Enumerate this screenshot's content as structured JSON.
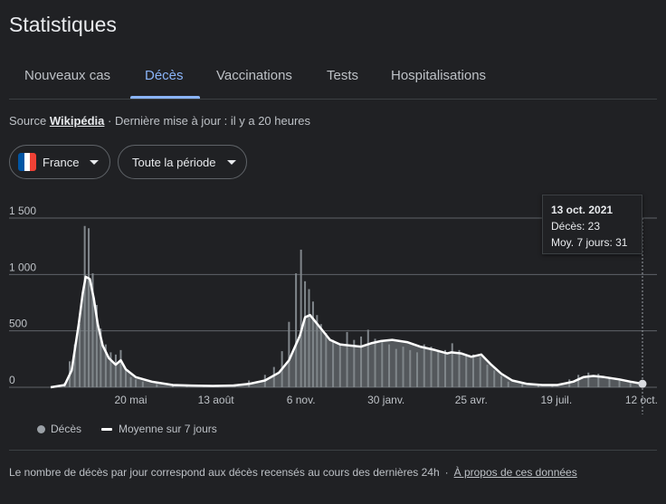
{
  "header": {
    "title": "Statistiques"
  },
  "tabs": [
    {
      "label": "Nouveaux cas",
      "active": false
    },
    {
      "label": "Décès",
      "active": true
    },
    {
      "label": "Vaccinations",
      "active": false
    },
    {
      "label": "Tests",
      "active": false
    },
    {
      "label": "Hospitalisations",
      "active": false
    }
  ],
  "source": {
    "prefix": "Source",
    "link": "Wikipédia",
    "updated": "· Dernière mise à jour : il y a 20 heures"
  },
  "filters": {
    "country": {
      "label": "France",
      "icon": "france-flag-icon",
      "flag_colors": [
        "#0055A4",
        "#FFFFFF",
        "#EF4135"
      ]
    },
    "period": {
      "label": "Toute la période"
    }
  },
  "tooltip": {
    "date": "13 oct. 2021",
    "deaths_line": "Décès: 23",
    "avg_line": "Moy. 7 jours: 31"
  },
  "legend": {
    "bars_label": "Décès",
    "line_label": "Moyenne sur 7 jours"
  },
  "footer": {
    "note": "Le nombre de décès par jour correspond aux décès recensés au cours des dernières 24h",
    "separator": "·",
    "link": "À propos de ces données"
  },
  "colors": {
    "background": "#202124",
    "accent": "#8ab4f8",
    "bars": "#80868b",
    "avg_line": "#ffffff",
    "grid": "#5f6368"
  },
  "chart_data": {
    "type": "bar",
    "title": "",
    "xlabel": "",
    "ylabel": "",
    "ylim": [
      0,
      1500
    ],
    "yticks": [
      "0",
      "500",
      "1 000",
      "1 500"
    ],
    "xticks": [
      "20 mai",
      "13 août",
      "6 nov.",
      "30 janv.",
      "25 avr.",
      "19 juil.",
      "12 oct."
    ],
    "grid": true,
    "x_range": [
      "2020-03-01",
      "2021-10-13"
    ],
    "series": [
      {
        "name": "Décès",
        "kind": "bar",
        "x": [
          "2020-03-10",
          "2020-03-15",
          "2020-03-20",
          "2020-03-25",
          "2020-03-30",
          "2020-04-04",
          "2020-04-08",
          "2020-04-12",
          "2020-04-16",
          "2020-04-20",
          "2020-04-25",
          "2020-04-30",
          "2020-05-05",
          "2020-05-10",
          "2020-05-15",
          "2020-05-20",
          "2020-05-25",
          "2020-06-01",
          "2020-06-15",
          "2020-07-01",
          "2020-07-15",
          "2020-08-01",
          "2020-08-15",
          "2020-09-01",
          "2020-09-15",
          "2020-10-01",
          "2020-10-10",
          "2020-10-18",
          "2020-10-25",
          "2020-11-01",
          "2020-11-06",
          "2020-11-10",
          "2020-11-14",
          "2020-11-18",
          "2020-11-22",
          "2020-11-26",
          "2020-12-01",
          "2020-12-08",
          "2020-12-15",
          "2020-12-22",
          "2020-12-29",
          "2021-01-05",
          "2021-01-12",
          "2021-01-19",
          "2021-01-26",
          "2021-02-02",
          "2021-02-09",
          "2021-02-16",
          "2021-02-23",
          "2021-03-02",
          "2021-03-09",
          "2021-03-16",
          "2021-03-23",
          "2021-03-30",
          "2021-04-06",
          "2021-04-13",
          "2021-04-20",
          "2021-04-27",
          "2021-05-04",
          "2021-05-11",
          "2021-05-18",
          "2021-05-25",
          "2021-06-01",
          "2021-06-15",
          "2021-07-01",
          "2021-07-15",
          "2021-08-01",
          "2021-08-10",
          "2021-08-20",
          "2021-08-30",
          "2021-09-10",
          "2021-09-20",
          "2021-10-01",
          "2021-10-13"
        ],
        "values": [
          5,
          40,
          230,
          380,
          560,
          1430,
          1410,
          1010,
          730,
          520,
          380,
          310,
          290,
          330,
          150,
          90,
          70,
          50,
          30,
          20,
          15,
          12,
          15,
          25,
          60,
          110,
          180,
          320,
          580,
          1010,
          1220,
          940,
          870,
          760,
          640,
          560,
          480,
          420,
          380,
          490,
          420,
          450,
          510,
          430,
          400,
          380,
          340,
          360,
          330,
          310,
          380,
          360,
          330,
          330,
          390,
          330,
          280,
          290,
          270,
          200,
          150,
          100,
          50,
          30,
          15,
          20,
          70,
          110,
          130,
          120,
          80,
          60,
          40,
          23
        ]
      },
      {
        "name": "Moyenne sur 7 jours",
        "kind": "line",
        "x": [
          "2020-03-01",
          "2020-03-15",
          "2020-03-22",
          "2020-03-29",
          "2020-04-02",
          "2020-04-05",
          "2020-04-09",
          "2020-04-13",
          "2020-04-17",
          "2020-04-22",
          "2020-04-28",
          "2020-05-05",
          "2020-05-10",
          "2020-05-15",
          "2020-05-25",
          "2020-06-10",
          "2020-07-01",
          "2020-07-20",
          "2020-08-10",
          "2020-08-30",
          "2020-09-15",
          "2020-10-01",
          "2020-10-15",
          "2020-10-25",
          "2020-11-05",
          "2020-11-10",
          "2020-11-15",
          "2020-11-25",
          "2020-12-05",
          "2020-12-15",
          "2020-12-25",
          "2021-01-05",
          "2021-01-15",
          "2021-01-25",
          "2021-02-05",
          "2021-02-20",
          "2021-03-05",
          "2021-03-20",
          "2021-04-01",
          "2021-04-05",
          "2021-04-15",
          "2021-04-25",
          "2021-05-05",
          "2021-05-15",
          "2021-05-25",
          "2021-06-05",
          "2021-06-20",
          "2021-07-05",
          "2021-07-20",
          "2021-08-05",
          "2021-08-15",
          "2021-08-25",
          "2021-09-05",
          "2021-09-20",
          "2021-10-01",
          "2021-10-13"
        ],
        "values": [
          0,
          20,
          150,
          560,
          830,
          980,
          960,
          790,
          560,
          370,
          260,
          200,
          240,
          160,
          90,
          50,
          20,
          15,
          12,
          15,
          30,
          60,
          130,
          240,
          460,
          620,
          640,
          530,
          420,
          380,
          370,
          360,
          390,
          410,
          420,
          400,
          360,
          330,
          300,
          310,
          300,
          270,
          290,
          200,
          120,
          60,
          30,
          20,
          20,
          50,
          90,
          100,
          90,
          70,
          50,
          31
        ]
      }
    ],
    "highlight": {
      "date": "13 oct. 2021",
      "deaths": 23,
      "avg7": 31
    }
  }
}
